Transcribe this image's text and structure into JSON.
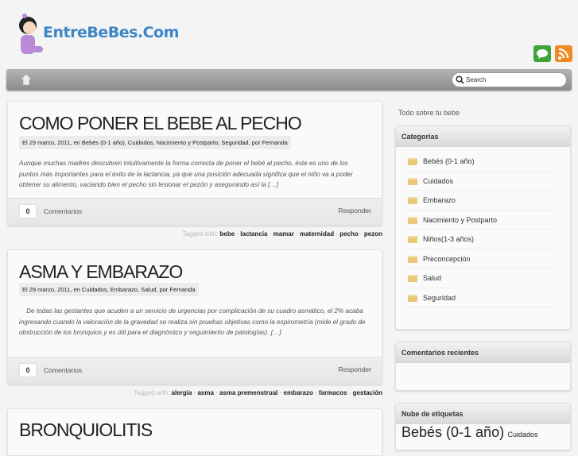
{
  "header": {
    "site_name": "EntreBeBes.Com",
    "tagline": "Todo sobre tu bebe",
    "search_placeholder": "Search"
  },
  "colors": {
    "chat": "#3fa33a",
    "rss": "#f08a24",
    "logo": "#3d86c6"
  },
  "posts": [
    {
      "title": "COMO PONER EL BEBE AL PECHO",
      "meta": "El 29 marzo, 2011, en Bebés (0-1 año), Cuidados, Nacimiento y Postparto, Seguridad, por Fernanda",
      "excerpt": "Aunque muchas madres descubren intuitivamente la forma correcta de poner el bebé al pecho, éste es uno de los puntos más importantes para el éxito de la lactancia, ya que una posición adecuada significa que el niño va a poder obtener su alimento, vaciando bien el pecho sin lesionar el pezón y asegurando así la […]",
      "comments": "0",
      "comments_label": "Comentarios",
      "reply": "Responder",
      "tags_label": "Tagged with:",
      "tags": [
        "bebe",
        "lactancia",
        "mamar",
        "maternidad",
        "pecho",
        "pezon"
      ]
    },
    {
      "title": "ASMA Y EMBARAZO",
      "meta": "El 29 marzo, 2011, en Cuidados, Embarazo, Salud, por Fernanda",
      "excerpt": "    De todas las gestantes que acuden a un servicio de urgencias por complicación de su cuadro asmático, el 2% acaba ingresando cuando la valoración de la gravedad se realiza sin pruebas objetivas como la espirometría (mide el grado de obstrucción de los bronquios y es útil para el diagnóstico y seguimiento de patologías). […]",
      "comments": "0",
      "comments_label": "Comentarios",
      "reply": "Responder",
      "tags_label": "Tagged with:",
      "tags": [
        "alergia",
        "asma",
        "asma premenstrual",
        "embarazo",
        "farmacos",
        "gestación"
      ]
    },
    {
      "title": "BRONQUIOLITIS"
    }
  ],
  "sidebar": {
    "categories_title": "Categorias",
    "categories": [
      "Bebés (0-1 año)",
      "Cuidados",
      "Embarazo",
      "Nacimiento y Postparto",
      "Niños(1-3 años)",
      "Preconcepción",
      "Salud",
      "Seguridad"
    ],
    "recent_comments_title": "Comentarios recientes",
    "tag_cloud_title": "Nube de etiquetas",
    "tag_cloud": [
      "Bebés (0-1 año)",
      "Cuidados"
    ]
  }
}
